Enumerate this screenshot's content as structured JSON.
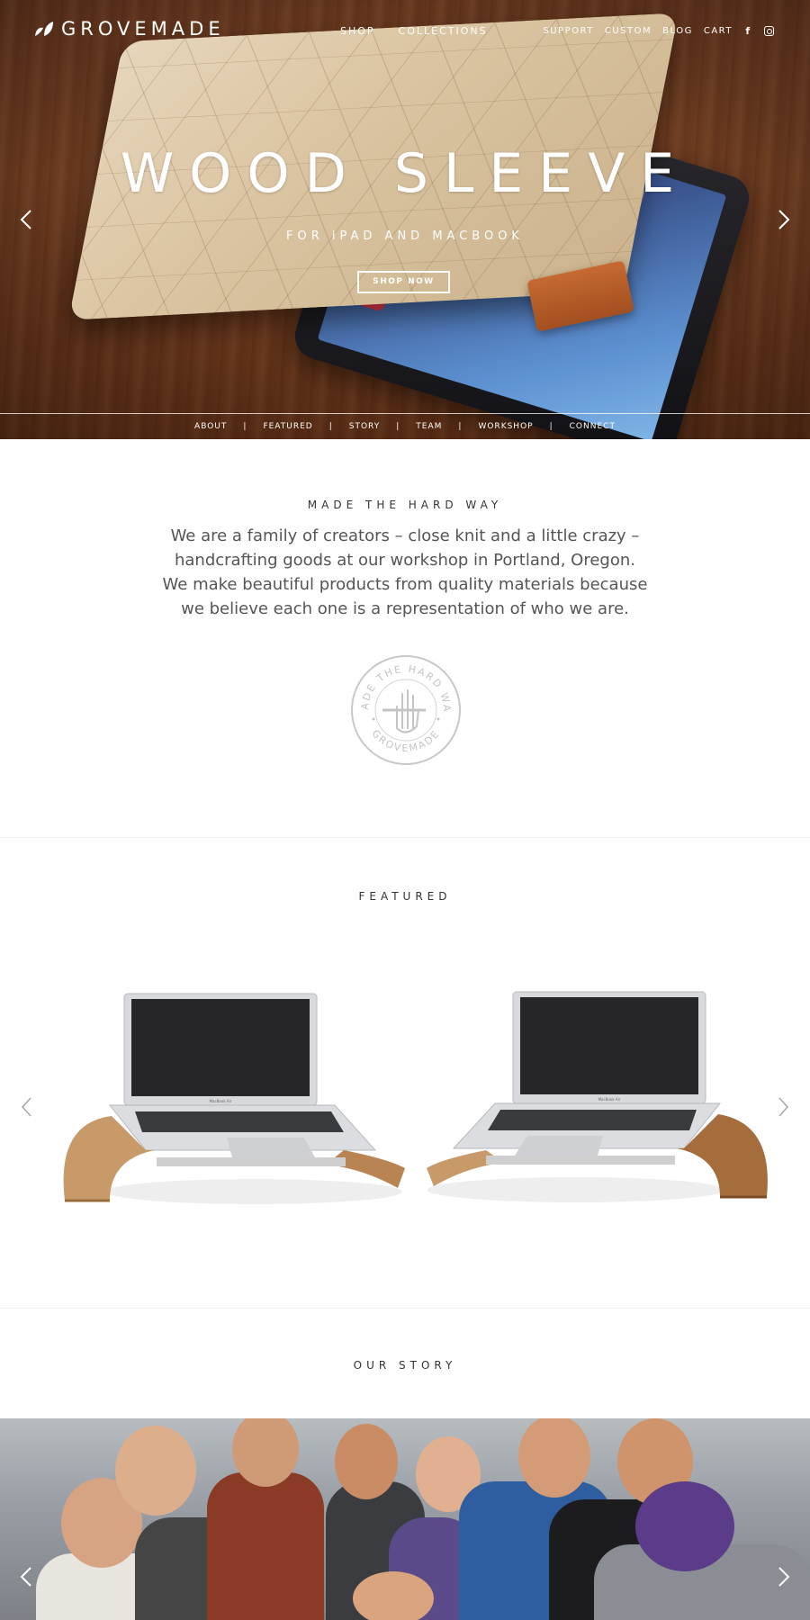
{
  "brand": {
    "name": "GROVEMADE"
  },
  "nav": {
    "primary": [
      "SHOP",
      "COLLECTIONS"
    ],
    "secondary": [
      "SUPPORT",
      "CUSTOM",
      "BLOG",
      "CART"
    ],
    "social_icons": [
      "facebook-icon",
      "instagram-icon"
    ]
  },
  "hero": {
    "title": "WOOD SLEEVE",
    "subtitle": "FOR iPAD AND MACBOOK",
    "cta": "SHOP NOW"
  },
  "subnav": {
    "items": [
      "ABOUT",
      "FEATURED",
      "STORY",
      "TEAM",
      "WORKSHOP",
      "CONNECT"
    ],
    "separator": "|"
  },
  "about": {
    "heading": "MADE THE HARD WAY",
    "body": "We are a family of creators – close knit and a little crazy – handcrafting goods at our workshop in Portland, Oregon. We make beautiful products from quality materials because we believe each one is a representation of who we are.",
    "seal_top": "MADE THE HARD WAY",
    "seal_bottom": "GROVEMADE"
  },
  "featured": {
    "heading": "FEATURED",
    "product_labels": [
      "MacBook Air",
      "MacBook Air"
    ]
  },
  "story": {
    "heading": "OUR STORY"
  },
  "colors": {
    "text": "#444444",
    "wood": "#7d4526",
    "white": "#ffffff"
  }
}
